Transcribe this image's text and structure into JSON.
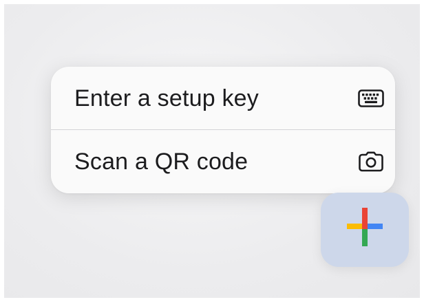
{
  "menu": {
    "items": [
      {
        "label": "Enter a setup key",
        "icon": "keyboard-icon"
      },
      {
        "label": "Scan a QR code",
        "icon": "camera-icon"
      }
    ]
  },
  "fab": {
    "icon": "google-plus-icon",
    "colors": {
      "blue": "#4285F4",
      "red": "#EA4335",
      "yellow": "#FBBC04",
      "green": "#34A853"
    },
    "background": "#cdd7ea"
  }
}
